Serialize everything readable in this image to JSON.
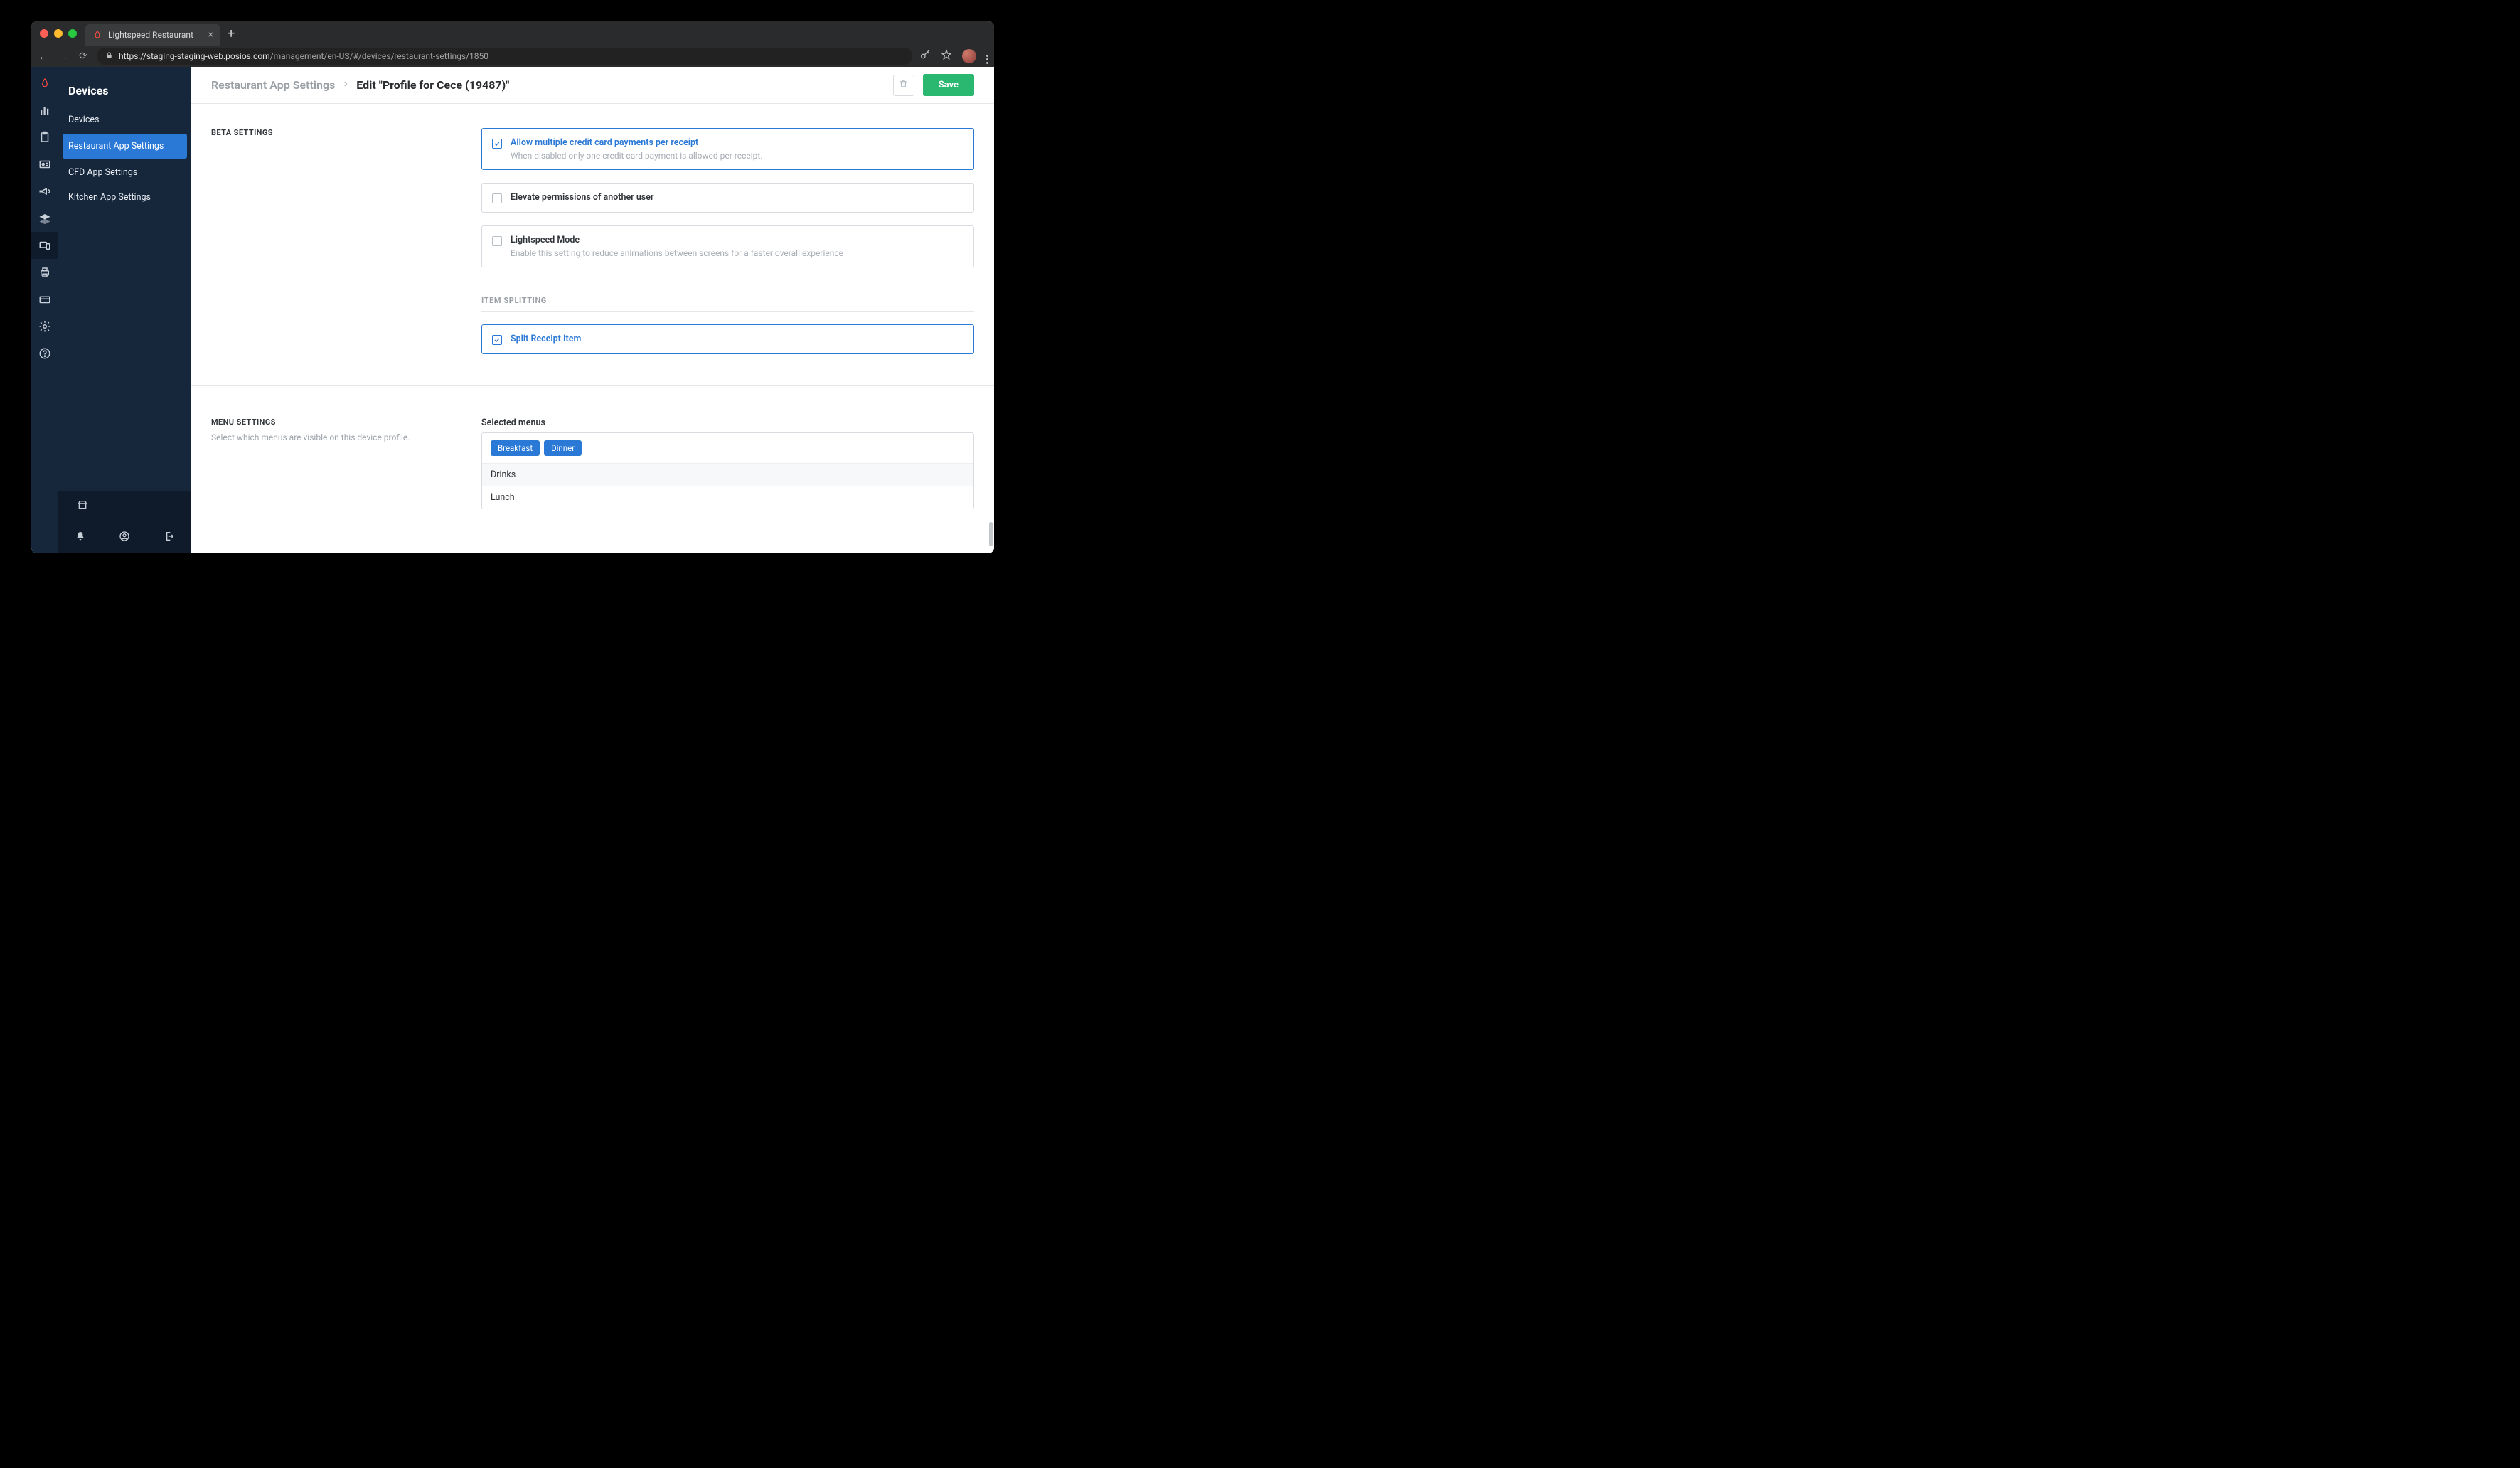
{
  "window": {
    "tab_title": "Lightspeed Restaurant",
    "url_host": "https://staging-staging-web.posios.com",
    "url_path": "/management/en-US/#/devices/restaurant-settings/1850"
  },
  "sidebar": {
    "title": "Devices",
    "items": [
      {
        "label": "Devices",
        "active": false
      },
      {
        "label": "Restaurant App Settings",
        "active": true
      },
      {
        "label": "CFD App Settings",
        "active": false
      },
      {
        "label": "Kitchen App Settings",
        "active": false
      }
    ]
  },
  "breadcrumb": {
    "parent": "Restaurant App Settings",
    "current": "Edit \"Profile for Cece (19487)\""
  },
  "actions": {
    "save_label": "Save"
  },
  "beta": {
    "heading": "BETA SETTINGS",
    "options": [
      {
        "title": "Allow multiple credit card payments per receipt",
        "subtitle": "When disabled only one credit card payment is allowed per receipt.",
        "checked": true
      },
      {
        "title": "Elevate permissions of another user",
        "subtitle": "",
        "checked": false
      },
      {
        "title": "Lightspeed Mode",
        "subtitle": "Enable this setting to reduce animations between screens for a faster overall experience",
        "checked": false
      }
    ],
    "item_splitting_heading": "ITEM SPLITTING",
    "split_option": {
      "title": "Split Receipt Item",
      "checked": true
    }
  },
  "menu_settings": {
    "heading": "MENU SETTINGS",
    "description": "Select which menus are visible on this device profile.",
    "panel_label": "Selected menus",
    "selected_tags": [
      "Breakfast",
      "Dinner"
    ],
    "available_rows": [
      "Drinks",
      "Lunch"
    ]
  }
}
